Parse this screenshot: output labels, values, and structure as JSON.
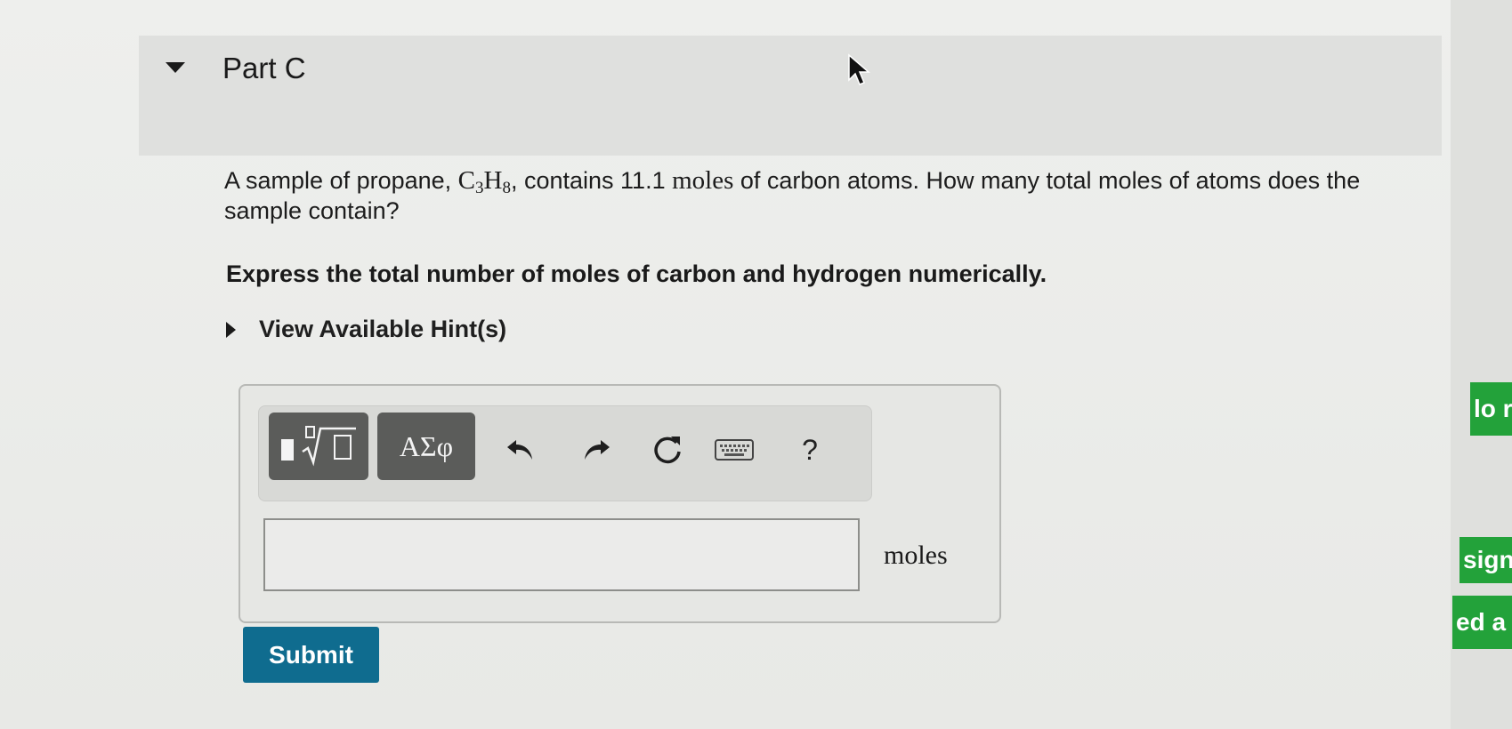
{
  "part": {
    "title": "Part C"
  },
  "question": {
    "text_before": "A sample of propane, ",
    "formula_c": "C",
    "formula_c_sub": "3",
    "formula_h": "H",
    "formula_h_sub": "8",
    "text_middle": ", contains 11.1 ",
    "moles_word": "moles",
    "text_after": " of carbon atoms. How many total moles of atoms does the sample contain?"
  },
  "instruction": "Express the total number of moles of carbon and hydrogen numerically.",
  "hints": {
    "label": "View Available Hint(s)"
  },
  "toolbar": {
    "symbols_label": "ΑΣφ",
    "help_label": "?"
  },
  "answer": {
    "value": "",
    "unit": "moles"
  },
  "submit": {
    "label": "Submit"
  },
  "side_tabs": [
    {
      "text": "lo r"
    },
    {
      "text": "sign"
    },
    {
      "text": "ed a l"
    }
  ]
}
